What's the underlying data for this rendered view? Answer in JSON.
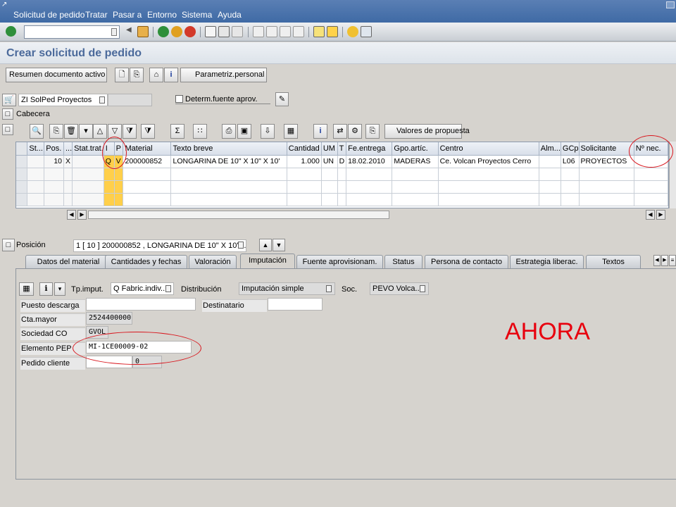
{
  "menu": [
    "Solicitud de pedido",
    "Tratar",
    "Pasar a",
    "Entorno",
    "Sistema",
    "Ayuda"
  ],
  "title": "Crear solicitud de pedido",
  "app_toolbar": {
    "summary_btn": "Resumen documento activo",
    "personal_btn": "Parametriz.personal"
  },
  "header": {
    "doc_type": "ZI SolPed Proyectos",
    "source_check": "Determ.fuente aprov.",
    "cabecera": "Cabecera"
  },
  "grid_toolbar": {
    "proposal_btn": "Valores de propuesta"
  },
  "grid": {
    "columns": [
      "St...",
      "Pos.",
      "...",
      "Stat.trat.",
      "I",
      "P",
      "Material",
      "Texto breve",
      "Cantidad",
      "UM",
      "T",
      "Fe.entrega",
      "Gpo.artíc.",
      "Centro",
      "Alm...",
      "GCp",
      "Solicitante",
      "Nº nec."
    ],
    "rows": [
      [
        "",
        "10",
        "X",
        "",
        "Q",
        "V",
        "200000852",
        "LONGARINA DE 10\" X 10\" X 10'",
        "1.000",
        "UN",
        "D",
        "18.02.2010",
        "MADERAS",
        "Ce. Volcan Proyectos Cerro",
        "",
        "L06",
        "PROYECTOS",
        ""
      ]
    ]
  },
  "position": {
    "label": "Posición",
    "value": "1 [ 10 ] 200000852 , LONGARINA DE 10\" X 10\" ..."
  },
  "tabs": [
    "Datos del material",
    "Cantidades y fechas",
    "Valoración",
    "Imputación",
    "Fuente aprovisionam.",
    "Status",
    "Persona de contacto",
    "Estrategia liberac.",
    "Textos"
  ],
  "imputacion": {
    "tp_imput_label": "Tp.imput.",
    "tp_imput_value": "Q Fabric.indiv....",
    "distribucion_label": "Distribución",
    "distribucion_value": "Imputación simple",
    "soc_label": "Soc.",
    "soc_value": "PEVO Volca...",
    "puesto_label": "Puesto descarga",
    "destinatario_label": "Destinatario",
    "cta_label": "Cta.mayor",
    "cta_value": "2524400000",
    "sociedad_label": "Sociedad CO",
    "sociedad_value": "GVOL",
    "pep_label": "Elemento PEP",
    "pep_value": "MI-1CE00009-02",
    "pedido_label": "Pedido cliente",
    "pedido_value": "0"
  },
  "annotation": "AHORA",
  "colors": {
    "menubar": "#4a73ab",
    "highlight": "#ffcf4a",
    "annotation": "#e8000e"
  }
}
